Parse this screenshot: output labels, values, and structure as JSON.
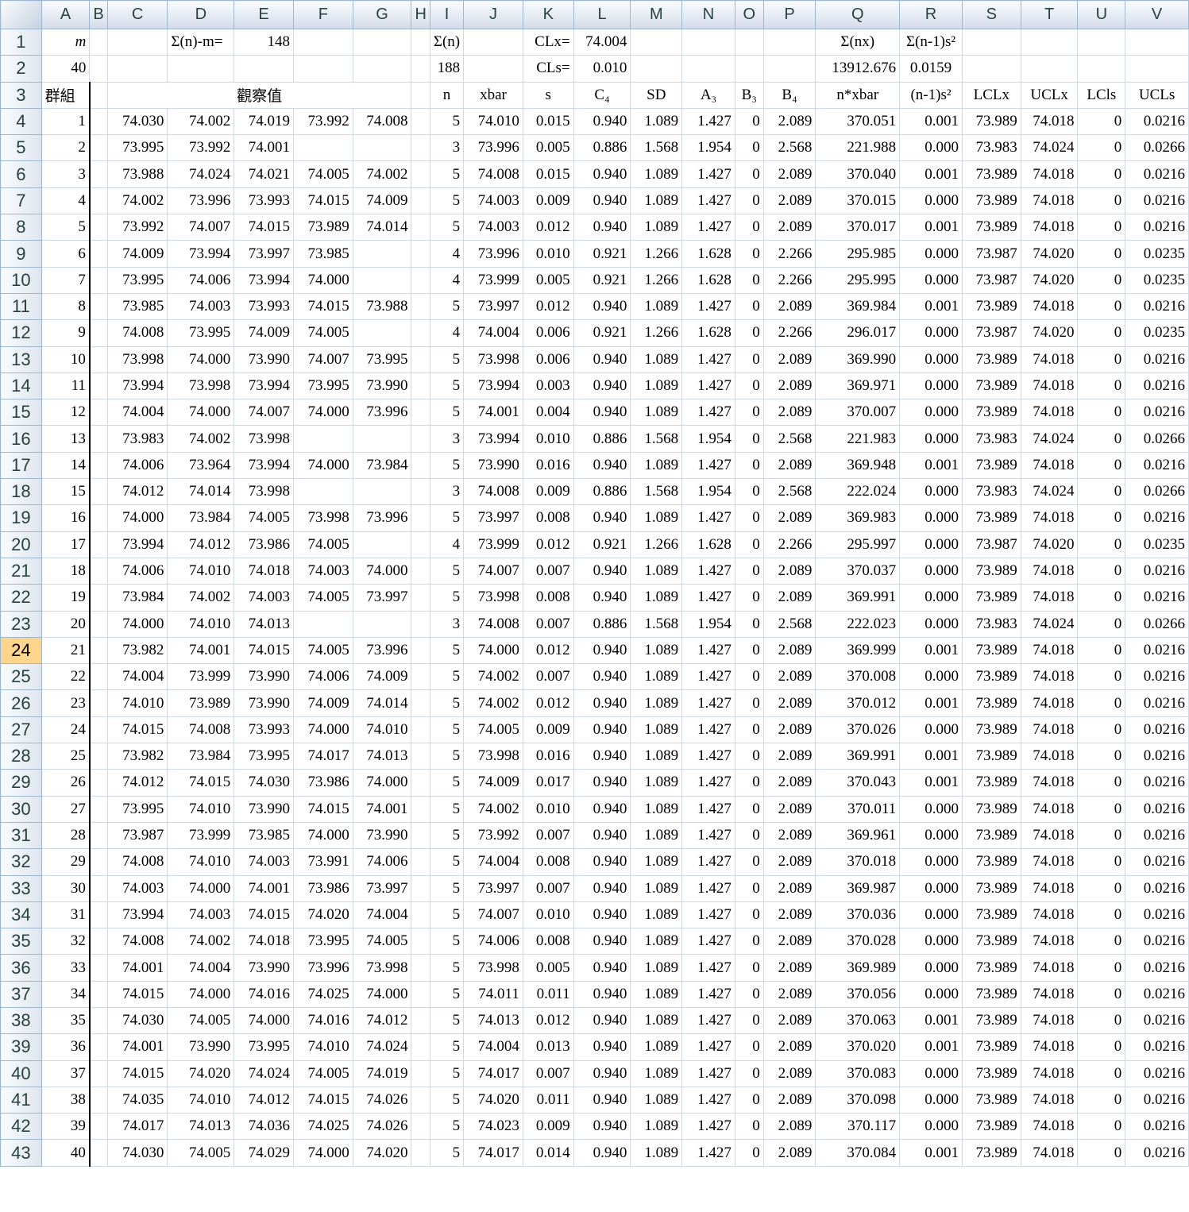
{
  "columns": [
    "A",
    "B",
    "C",
    "D",
    "E",
    "F",
    "G",
    "H",
    "I",
    "J",
    "K",
    "L",
    "M",
    "N",
    "O",
    "P",
    "Q",
    "R",
    "S",
    "T",
    "U",
    "V"
  ],
  "active_row": 24,
  "row1": {
    "A": "m",
    "D": "Σ(n)-m=",
    "E": "148",
    "I": "Σ(n)",
    "K": "CLx=",
    "L": "74.004",
    "Q": "Σ(nx)",
    "R": "Σ(n-1)s²"
  },
  "row2": {
    "A": "40",
    "I": "188",
    "K": "CLs=",
    "L": "0.010",
    "Q": "13912.676",
    "R": "0.0159"
  },
  "row3": {
    "A": "群組",
    "merge_CG": "觀察值",
    "I": "n",
    "J": "xbar",
    "K": "s",
    "L": "C₄",
    "M": "SD",
    "N": "A₃",
    "O": "B₃",
    "P": "B₄",
    "Q": "n*xbar",
    "R": "(n-1)s²",
    "S": "LCLx",
    "T": "UCLx",
    "U": "LCls",
    "V": "UCLs"
  },
  "rows": [
    [
      "1",
      "74.030",
      "74.002",
      "74.019",
      "73.992",
      "74.008",
      "5",
      "74.010",
      "0.015",
      "0.940",
      "1.089",
      "1.427",
      "0",
      "2.089",
      "370.051",
      "0.001",
      "73.989",
      "74.018",
      "0",
      "0.0216"
    ],
    [
      "2",
      "73.995",
      "73.992",
      "74.001",
      "",
      "",
      "3",
      "73.996",
      "0.005",
      "0.886",
      "1.568",
      "1.954",
      "0",
      "2.568",
      "221.988",
      "0.000",
      "73.983",
      "74.024",
      "0",
      "0.0266"
    ],
    [
      "3",
      "73.988",
      "74.024",
      "74.021",
      "74.005",
      "74.002",
      "5",
      "74.008",
      "0.015",
      "0.940",
      "1.089",
      "1.427",
      "0",
      "2.089",
      "370.040",
      "0.001",
      "73.989",
      "74.018",
      "0",
      "0.0216"
    ],
    [
      "4",
      "74.002",
      "73.996",
      "73.993",
      "74.015",
      "74.009",
      "5",
      "74.003",
      "0.009",
      "0.940",
      "1.089",
      "1.427",
      "0",
      "2.089",
      "370.015",
      "0.000",
      "73.989",
      "74.018",
      "0",
      "0.0216"
    ],
    [
      "5",
      "73.992",
      "74.007",
      "74.015",
      "73.989",
      "74.014",
      "5",
      "74.003",
      "0.012",
      "0.940",
      "1.089",
      "1.427",
      "0",
      "2.089",
      "370.017",
      "0.001",
      "73.989",
      "74.018",
      "0",
      "0.0216"
    ],
    [
      "6",
      "74.009",
      "73.994",
      "73.997",
      "73.985",
      "",
      "4",
      "73.996",
      "0.010",
      "0.921",
      "1.266",
      "1.628",
      "0",
      "2.266",
      "295.985",
      "0.000",
      "73.987",
      "74.020",
      "0",
      "0.0235"
    ],
    [
      "7",
      "73.995",
      "74.006",
      "73.994",
      "74.000",
      "",
      "4",
      "73.999",
      "0.005",
      "0.921",
      "1.266",
      "1.628",
      "0",
      "2.266",
      "295.995",
      "0.000",
      "73.987",
      "74.020",
      "0",
      "0.0235"
    ],
    [
      "8",
      "73.985",
      "74.003",
      "73.993",
      "74.015",
      "73.988",
      "5",
      "73.997",
      "0.012",
      "0.940",
      "1.089",
      "1.427",
      "0",
      "2.089",
      "369.984",
      "0.001",
      "73.989",
      "74.018",
      "0",
      "0.0216"
    ],
    [
      "9",
      "74.008",
      "73.995",
      "74.009",
      "74.005",
      "",
      "4",
      "74.004",
      "0.006",
      "0.921",
      "1.266",
      "1.628",
      "0",
      "2.266",
      "296.017",
      "0.000",
      "73.987",
      "74.020",
      "0",
      "0.0235"
    ],
    [
      "10",
      "73.998",
      "74.000",
      "73.990",
      "74.007",
      "73.995",
      "5",
      "73.998",
      "0.006",
      "0.940",
      "1.089",
      "1.427",
      "0",
      "2.089",
      "369.990",
      "0.000",
      "73.989",
      "74.018",
      "0",
      "0.0216"
    ],
    [
      "11",
      "73.994",
      "73.998",
      "73.994",
      "73.995",
      "73.990",
      "5",
      "73.994",
      "0.003",
      "0.940",
      "1.089",
      "1.427",
      "0",
      "2.089",
      "369.971",
      "0.000",
      "73.989",
      "74.018",
      "0",
      "0.0216"
    ],
    [
      "12",
      "74.004",
      "74.000",
      "74.007",
      "74.000",
      "73.996",
      "5",
      "74.001",
      "0.004",
      "0.940",
      "1.089",
      "1.427",
      "0",
      "2.089",
      "370.007",
      "0.000",
      "73.989",
      "74.018",
      "0",
      "0.0216"
    ],
    [
      "13",
      "73.983",
      "74.002",
      "73.998",
      "",
      "",
      "3",
      "73.994",
      "0.010",
      "0.886",
      "1.568",
      "1.954",
      "0",
      "2.568",
      "221.983",
      "0.000",
      "73.983",
      "74.024",
      "0",
      "0.0266"
    ],
    [
      "14",
      "74.006",
      "73.964",
      "73.994",
      "74.000",
      "73.984",
      "5",
      "73.990",
      "0.016",
      "0.940",
      "1.089",
      "1.427",
      "0",
      "2.089",
      "369.948",
      "0.001",
      "73.989",
      "74.018",
      "0",
      "0.0216"
    ],
    [
      "15",
      "74.012",
      "74.014",
      "73.998",
      "",
      "",
      "3",
      "74.008",
      "0.009",
      "0.886",
      "1.568",
      "1.954",
      "0",
      "2.568",
      "222.024",
      "0.000",
      "73.983",
      "74.024",
      "0",
      "0.0266"
    ],
    [
      "16",
      "74.000",
      "73.984",
      "74.005",
      "73.998",
      "73.996",
      "5",
      "73.997",
      "0.008",
      "0.940",
      "1.089",
      "1.427",
      "0",
      "2.089",
      "369.983",
      "0.000",
      "73.989",
      "74.018",
      "0",
      "0.0216"
    ],
    [
      "17",
      "73.994",
      "74.012",
      "73.986",
      "74.005",
      "",
      "4",
      "73.999",
      "0.012",
      "0.921",
      "1.266",
      "1.628",
      "0",
      "2.266",
      "295.997",
      "0.000",
      "73.987",
      "74.020",
      "0",
      "0.0235"
    ],
    [
      "18",
      "74.006",
      "74.010",
      "74.018",
      "74.003",
      "74.000",
      "5",
      "74.007",
      "0.007",
      "0.940",
      "1.089",
      "1.427",
      "0",
      "2.089",
      "370.037",
      "0.000",
      "73.989",
      "74.018",
      "0",
      "0.0216"
    ],
    [
      "19",
      "73.984",
      "74.002",
      "74.003",
      "74.005",
      "73.997",
      "5",
      "73.998",
      "0.008",
      "0.940",
      "1.089",
      "1.427",
      "0",
      "2.089",
      "369.991",
      "0.000",
      "73.989",
      "74.018",
      "0",
      "0.0216"
    ],
    [
      "20",
      "74.000",
      "74.010",
      "74.013",
      "",
      "",
      "3",
      "74.008",
      "0.007",
      "0.886",
      "1.568",
      "1.954",
      "0",
      "2.568",
      "222.023",
      "0.000",
      "73.983",
      "74.024",
      "0",
      "0.0266"
    ],
    [
      "21",
      "73.982",
      "74.001",
      "74.015",
      "74.005",
      "73.996",
      "5",
      "74.000",
      "0.012",
      "0.940",
      "1.089",
      "1.427",
      "0",
      "2.089",
      "369.999",
      "0.001",
      "73.989",
      "74.018",
      "0",
      "0.0216"
    ],
    [
      "22",
      "74.004",
      "73.999",
      "73.990",
      "74.006",
      "74.009",
      "5",
      "74.002",
      "0.007",
      "0.940",
      "1.089",
      "1.427",
      "0",
      "2.089",
      "370.008",
      "0.000",
      "73.989",
      "74.018",
      "0",
      "0.0216"
    ],
    [
      "23",
      "74.010",
      "73.989",
      "73.990",
      "74.009",
      "74.014",
      "5",
      "74.002",
      "0.012",
      "0.940",
      "1.089",
      "1.427",
      "0",
      "2.089",
      "370.012",
      "0.001",
      "73.989",
      "74.018",
      "0",
      "0.0216"
    ],
    [
      "24",
      "74.015",
      "74.008",
      "73.993",
      "74.000",
      "74.010",
      "5",
      "74.005",
      "0.009",
      "0.940",
      "1.089",
      "1.427",
      "0",
      "2.089",
      "370.026",
      "0.000",
      "73.989",
      "74.018",
      "0",
      "0.0216"
    ],
    [
      "25",
      "73.982",
      "73.984",
      "73.995",
      "74.017",
      "74.013",
      "5",
      "73.998",
      "0.016",
      "0.940",
      "1.089",
      "1.427",
      "0",
      "2.089",
      "369.991",
      "0.001",
      "73.989",
      "74.018",
      "0",
      "0.0216"
    ],
    [
      "26",
      "74.012",
      "74.015",
      "74.030",
      "73.986",
      "74.000",
      "5",
      "74.009",
      "0.017",
      "0.940",
      "1.089",
      "1.427",
      "0",
      "2.089",
      "370.043",
      "0.001",
      "73.989",
      "74.018",
      "0",
      "0.0216"
    ],
    [
      "27",
      "73.995",
      "74.010",
      "73.990",
      "74.015",
      "74.001",
      "5",
      "74.002",
      "0.010",
      "0.940",
      "1.089",
      "1.427",
      "0",
      "2.089",
      "370.011",
      "0.000",
      "73.989",
      "74.018",
      "0",
      "0.0216"
    ],
    [
      "28",
      "73.987",
      "73.999",
      "73.985",
      "74.000",
      "73.990",
      "5",
      "73.992",
      "0.007",
      "0.940",
      "1.089",
      "1.427",
      "0",
      "2.089",
      "369.961",
      "0.000",
      "73.989",
      "74.018",
      "0",
      "0.0216"
    ],
    [
      "29",
      "74.008",
      "74.010",
      "74.003",
      "73.991",
      "74.006",
      "5",
      "74.004",
      "0.008",
      "0.940",
      "1.089",
      "1.427",
      "0",
      "2.089",
      "370.018",
      "0.000",
      "73.989",
      "74.018",
      "0",
      "0.0216"
    ],
    [
      "30",
      "74.003",
      "74.000",
      "74.001",
      "73.986",
      "73.997",
      "5",
      "73.997",
      "0.007",
      "0.940",
      "1.089",
      "1.427",
      "0",
      "2.089",
      "369.987",
      "0.000",
      "73.989",
      "74.018",
      "0",
      "0.0216"
    ],
    [
      "31",
      "73.994",
      "74.003",
      "74.015",
      "74.020",
      "74.004",
      "5",
      "74.007",
      "0.010",
      "0.940",
      "1.089",
      "1.427",
      "0",
      "2.089",
      "370.036",
      "0.000",
      "73.989",
      "74.018",
      "0",
      "0.0216"
    ],
    [
      "32",
      "74.008",
      "74.002",
      "74.018",
      "73.995",
      "74.005",
      "5",
      "74.006",
      "0.008",
      "0.940",
      "1.089",
      "1.427",
      "0",
      "2.089",
      "370.028",
      "0.000",
      "73.989",
      "74.018",
      "0",
      "0.0216"
    ],
    [
      "33",
      "74.001",
      "74.004",
      "73.990",
      "73.996",
      "73.998",
      "5",
      "73.998",
      "0.005",
      "0.940",
      "1.089",
      "1.427",
      "0",
      "2.089",
      "369.989",
      "0.000",
      "73.989",
      "74.018",
      "0",
      "0.0216"
    ],
    [
      "34",
      "74.015",
      "74.000",
      "74.016",
      "74.025",
      "74.000",
      "5",
      "74.011",
      "0.011",
      "0.940",
      "1.089",
      "1.427",
      "0",
      "2.089",
      "370.056",
      "0.000",
      "73.989",
      "74.018",
      "0",
      "0.0216"
    ],
    [
      "35",
      "74.030",
      "74.005",
      "74.000",
      "74.016",
      "74.012",
      "5",
      "74.013",
      "0.012",
      "0.940",
      "1.089",
      "1.427",
      "0",
      "2.089",
      "370.063",
      "0.001",
      "73.989",
      "74.018",
      "0",
      "0.0216"
    ],
    [
      "36",
      "74.001",
      "73.990",
      "73.995",
      "74.010",
      "74.024",
      "5",
      "74.004",
      "0.013",
      "0.940",
      "1.089",
      "1.427",
      "0",
      "2.089",
      "370.020",
      "0.001",
      "73.989",
      "74.018",
      "0",
      "0.0216"
    ],
    [
      "37",
      "74.015",
      "74.020",
      "74.024",
      "74.005",
      "74.019",
      "5",
      "74.017",
      "0.007",
      "0.940",
      "1.089",
      "1.427",
      "0",
      "2.089",
      "370.083",
      "0.000",
      "73.989",
      "74.018",
      "0",
      "0.0216"
    ],
    [
      "38",
      "74.035",
      "74.010",
      "74.012",
      "74.015",
      "74.026",
      "5",
      "74.020",
      "0.011",
      "0.940",
      "1.089",
      "1.427",
      "0",
      "2.089",
      "370.098",
      "0.000",
      "73.989",
      "74.018",
      "0",
      "0.0216"
    ],
    [
      "39",
      "74.017",
      "74.013",
      "74.036",
      "74.025",
      "74.026",
      "5",
      "74.023",
      "0.009",
      "0.940",
      "1.089",
      "1.427",
      "0",
      "2.089",
      "370.117",
      "0.000",
      "73.989",
      "74.018",
      "0",
      "0.0216"
    ],
    [
      "40",
      "74.030",
      "74.005",
      "74.029",
      "74.000",
      "74.020",
      "5",
      "74.017",
      "0.014",
      "0.940",
      "1.089",
      "1.427",
      "0",
      "2.089",
      "370.084",
      "0.001",
      "73.989",
      "74.018",
      "0",
      "0.0216"
    ]
  ],
  "colors": {
    "header_bg": "#dfe5ee",
    "grid_line": "#d0d7e5",
    "active_row_header": "#ffd58d"
  }
}
